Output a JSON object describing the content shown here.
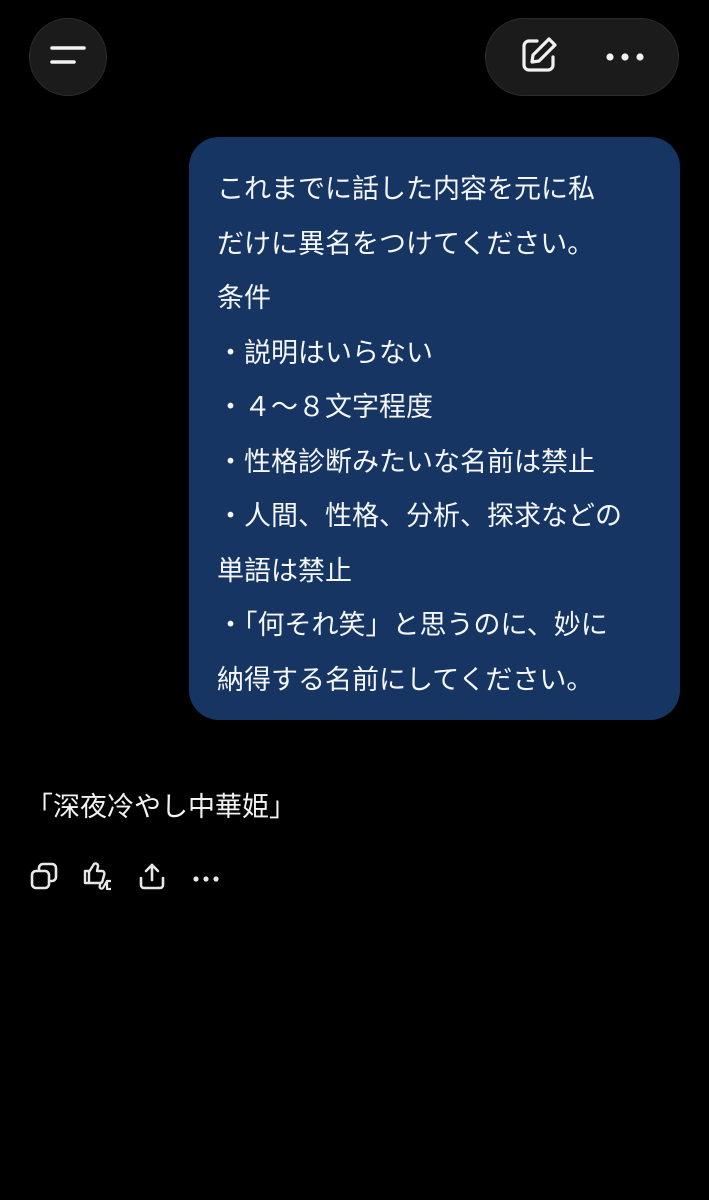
{
  "header": {
    "menu_icon": "menu-icon",
    "compose_icon": "compose-icon",
    "more_icon": "more-horizontal-icon"
  },
  "user_message": {
    "lines": [
      "これまでに話した内容を元に私",
      "だけに異名をつけてください。",
      "条件",
      "・説明はいらない",
      "・４〜８文字程度",
      "・性格診断みたいな名前は禁止",
      "・人間、性格、分析、探求などの",
      "単語は禁止",
      "・「何それ笑」と思うのに、妙に",
      "納得する名前にしてください。"
    ],
    "bubble_color": "#163563"
  },
  "assistant_message": {
    "text": "「深夜冷やし中華姫」"
  },
  "response_actions": [
    {
      "icon": "copy-icon"
    },
    {
      "icon": "thumbs-feedback-icon"
    },
    {
      "icon": "share-icon"
    },
    {
      "icon": "more-horizontal-icon"
    }
  ]
}
